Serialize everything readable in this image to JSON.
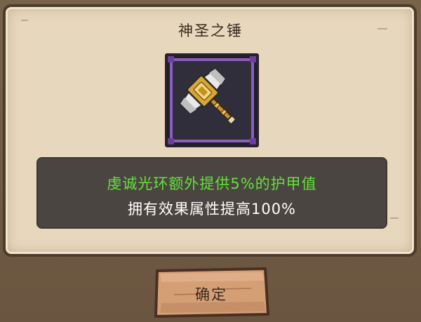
{
  "dialog": {
    "title": "神圣之锤",
    "item": {
      "icon": "holy-hammer-icon",
      "rarity_color": "#8a5fb8"
    },
    "description": {
      "bonus_text": "虔诚光环额外提供5%的护甲值",
      "bonus_color": "#63e23a",
      "effect_text": "拥有效果属性提高100%"
    },
    "confirm_label": "确定"
  }
}
